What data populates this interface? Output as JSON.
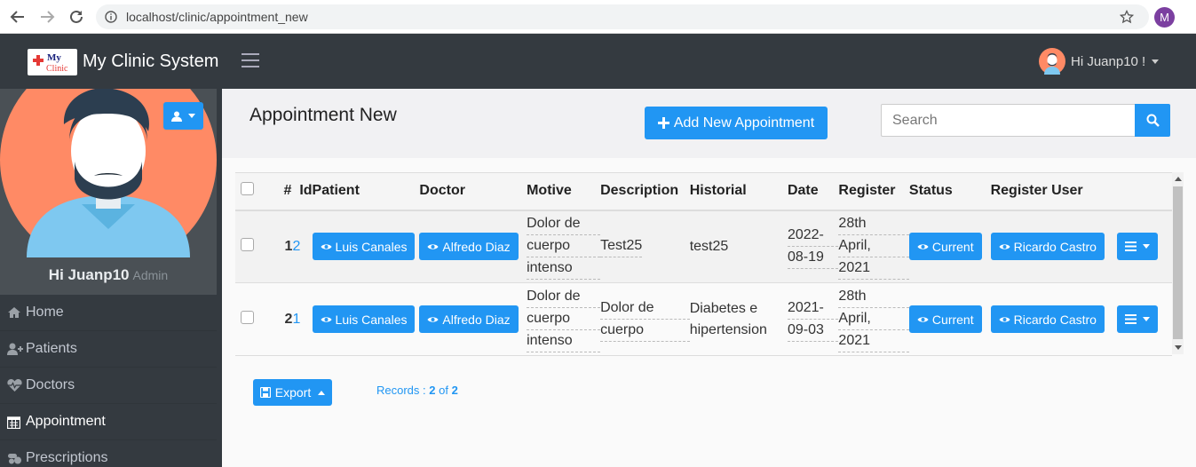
{
  "browser": {
    "url": "localhost/clinic/appointment_new",
    "profile_initial": "M"
  },
  "header": {
    "logo_text_top": "My",
    "logo_text_bottom": "Clinic",
    "title": "My Clinic System",
    "user_greeting": "Hi Juanp10 !"
  },
  "sidebar": {
    "greeting": "Hi Juanp10",
    "role": "Admin",
    "items": [
      {
        "label": "Home",
        "icon": "home-icon"
      },
      {
        "label": "Patients",
        "icon": "user-plus-icon"
      },
      {
        "label": "Doctors",
        "icon": "heartbeat-icon"
      },
      {
        "label": "Appointment",
        "icon": "calendar-icon"
      },
      {
        "label": "Prescriptions",
        "icon": "pills-icon"
      }
    ]
  },
  "main": {
    "page_title": "Appointment New",
    "add_button": "Add New Appointment",
    "search_placeholder": "Search"
  },
  "table": {
    "headers": {
      "num": "#",
      "id": "Id",
      "patient": "Patient",
      "doctor": "Doctor",
      "motive": "Motive",
      "description": "Description",
      "historial": "Historial",
      "date": "Date",
      "register": "Register",
      "status": "Status",
      "register_user": "Register User"
    },
    "rows": [
      {
        "num": "1",
        "id": "2",
        "patient": "Luis Canales",
        "doctor": "Alfredo Diaz",
        "motive": [
          "Dolor de",
          "cuerpo",
          "intenso"
        ],
        "description": [
          "Test25"
        ],
        "historial": [
          "test25"
        ],
        "date": [
          "2022-",
          "08-19"
        ],
        "register": [
          "28th",
          "April,",
          "2021"
        ],
        "status": "Current",
        "register_user": "Ricardo Castro"
      },
      {
        "num": "2",
        "id": "1",
        "patient": "Luis Canales",
        "doctor": "Alfredo Diaz",
        "motive": [
          "Dolor de",
          "cuerpo",
          "intenso"
        ],
        "description": [
          "Dolor de",
          "cuerpo"
        ],
        "historial": [
          "Diabetes e",
          "hipertension"
        ],
        "date": [
          "2021-",
          "09-03"
        ],
        "register": [
          "28th",
          "April,",
          "2021"
        ],
        "status": "Current",
        "register_user": "Ricardo Castro"
      }
    ]
  },
  "footer": {
    "export_label": "Export",
    "records_prefix": "Records : ",
    "records_shown": "2",
    "records_of": " of ",
    "records_total": "2"
  },
  "colors": {
    "accent": "#2196f3",
    "header_bg": "#343a40",
    "avatar_bg": "#ff8a65"
  }
}
